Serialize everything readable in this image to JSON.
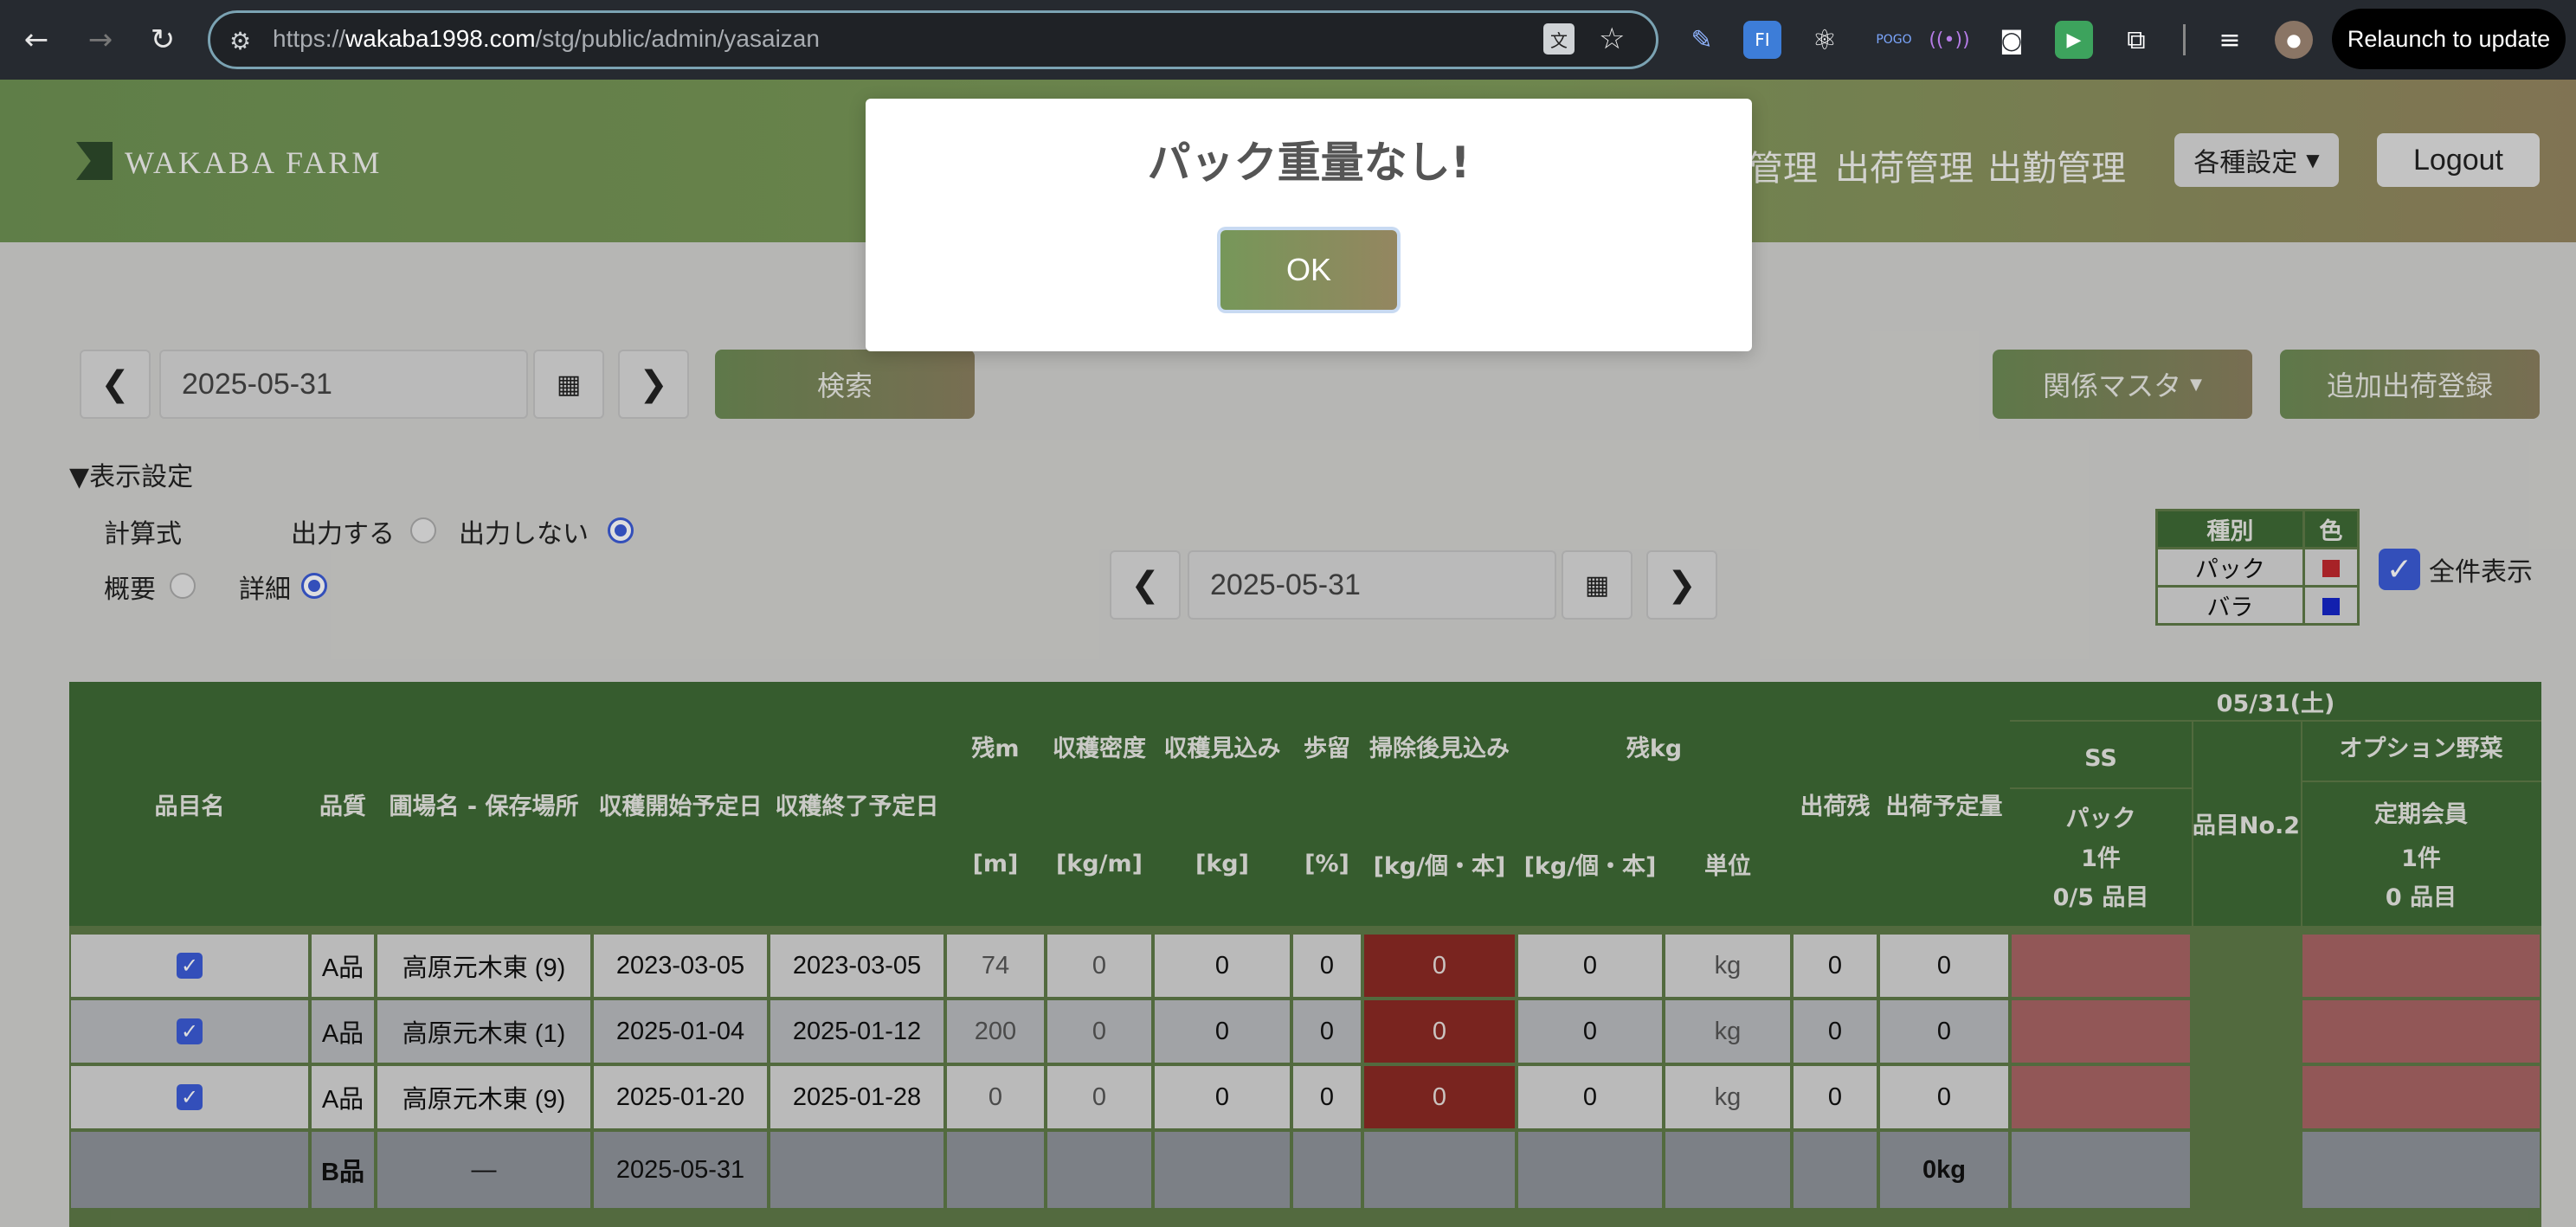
{
  "browser": {
    "url_scheme": "https://",
    "url_host": "wakaba1998.com",
    "url_path": "/stg/public/admin/yasaizan",
    "relaunch_label": "Relaunch to update"
  },
  "header": {
    "logo_text": "WAKABA FARM",
    "nav_partial": "管理",
    "nav": [
      "出荷管理",
      "出勤管理"
    ],
    "settings_label": "各種設定",
    "logout_label": "Logout"
  },
  "toolbar": {
    "date_top": "2025-05-31",
    "search_label": "検索",
    "master_label": "関係マスタ",
    "add_label": "追加出荷登録",
    "date_mid": "2025-05-31"
  },
  "display_settings": {
    "title": "▼表示設定",
    "formula_label": "計算式",
    "output_on": "出力する",
    "output_off": "出力しない",
    "summary_label": "概要",
    "detail_label": "詳細"
  },
  "legend": {
    "col_type": "種別",
    "col_color": "色",
    "rows": [
      {
        "type": "パック",
        "color": "#c0282d"
      },
      {
        "type": "バラ",
        "color": "#1525c8"
      }
    ]
  },
  "all_display_label": "全件表示",
  "table": {
    "headers": {
      "item": "品目名",
      "quality": "品質",
      "field": "圃場名 - 保存場所",
      "start": "収穫開始予定日",
      "end": "収穫終了予定日",
      "rem_m": "残m",
      "rem_m_unit": "[m]",
      "density": "収穫密度",
      "density_unit": "[kg/m]",
      "forecast": "収穫見込み",
      "forecast_unit": "[kg]",
      "yield": "歩留",
      "yield_unit": "[%]",
      "after_clean": "掃除後見込み",
      "after_clean_unit": "[kg/個・本]",
      "rem_kg": "残kg",
      "rem_kg_unit": "[kg/個・本]",
      "unit": "単位",
      "ship_rem": "出荷残",
      "ship_plan": "出荷予定量",
      "date": "05/31(土)",
      "ss": "SS",
      "pack": "パック",
      "pack_count": "1件",
      "pack_items": "0/5 品目",
      "item_no2": "品目No.2",
      "option_veg": "オプション野菜",
      "member": "定期会員",
      "member_count": "1件",
      "member_items": "0 品目"
    },
    "rows": [
      {
        "quality": "A品",
        "field": "高原元木東 (9)",
        "start": "2023-03-05",
        "end": "2023-03-05",
        "rem_m": "74",
        "density": "0",
        "forecast": "0",
        "yield": "0",
        "after_clean": "0",
        "rem_kg": "0",
        "unit": "kg",
        "ship_rem": "0",
        "ship_plan": "0"
      },
      {
        "quality": "A品",
        "field": "高原元木東 (1)",
        "start": "2025-01-04",
        "end": "2025-01-12",
        "rem_m": "200",
        "density": "0",
        "forecast": "0",
        "yield": "0",
        "after_clean": "0",
        "rem_kg": "0",
        "unit": "kg",
        "ship_rem": "0",
        "ship_plan": "0"
      },
      {
        "quality": "A品",
        "field": "高原元木東 (9)",
        "start": "2025-01-20",
        "end": "2025-01-28",
        "rem_m": "0",
        "density": "0",
        "forecast": "0",
        "yield": "0",
        "after_clean": "0",
        "rem_kg": "0",
        "unit": "kg",
        "ship_rem": "0",
        "ship_plan": "0"
      }
    ],
    "b_row": {
      "quality": "B品",
      "field": "―",
      "start": "2025-05-31",
      "ship_plan": "0kg"
    }
  },
  "modal": {
    "title": "パック重量なし!",
    "ok_label": "OK"
  }
}
